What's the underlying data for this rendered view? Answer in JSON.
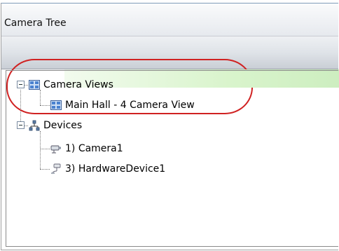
{
  "panel": {
    "title": "Camera Tree"
  },
  "tree": {
    "camera_views": {
      "label": "Camera Views",
      "children": [
        {
          "label": "Main Hall - 4 Camera View",
          "icon": "camera-view-grid-icon"
        }
      ]
    },
    "devices": {
      "label": "Devices",
      "children": [
        {
          "label": "1) Camera1",
          "icon": "camera-icon"
        },
        {
          "label": "3) HardwareDevice1",
          "icon": "hardware-device-icon"
        }
      ]
    }
  },
  "colors": {
    "annotation_oval": "#d02222",
    "selection_highlight": "#d9f4cc"
  }
}
